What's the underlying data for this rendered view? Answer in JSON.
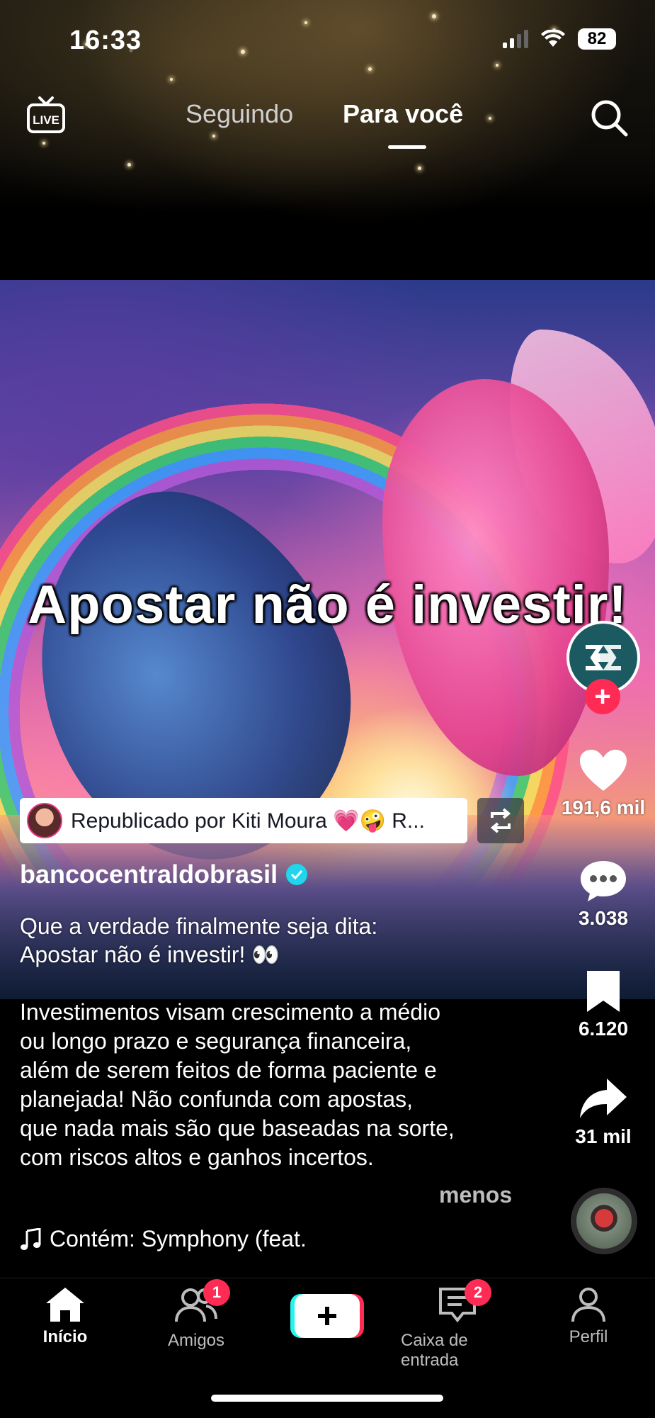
{
  "status_bar": {
    "time": "16:33",
    "battery": "82"
  },
  "top_nav": {
    "tabs": [
      {
        "label": "Seguindo",
        "active": false
      },
      {
        "label": "Para você",
        "active": true
      }
    ],
    "icons": [
      "live-icon",
      "search-icon"
    ]
  },
  "video": {
    "overlay_text": "Apostar não é investir!",
    "colors": {
      "accent": "#fe2c55",
      "verified": "#20d5ec"
    }
  },
  "right_rail": {
    "likes": "191,6 mil",
    "comments": "3.038",
    "saves": "6.120",
    "shares": "31 mil"
  },
  "post": {
    "repost_text": "Republicado por Kiti Moura 💗🤪 R...",
    "username": "bancocentraldobrasil",
    "caption_lines": [
      "Que a verdade finalmente seja dita:",
      "Apostar não é investir! 👀"
    ],
    "description_lines": [
      "Investimentos visam crescimento a médio",
      "ou longo prazo e segurança financeira,",
      "além de serem feitos de forma paciente e",
      "planejada! Não confunda com apostas,",
      "que nada mais são que baseadas na sorte,",
      "com riscos altos e ganhos incertos."
    ],
    "less_label": "menos",
    "music": "Contém: Symphony (feat."
  },
  "bottom_nav": {
    "items": [
      {
        "label": "Início"
      },
      {
        "label": "Amigos",
        "badge": "1"
      },
      {
        "label": ""
      },
      {
        "label": "Caixa de entrada",
        "badge": "2"
      },
      {
        "label": "Perfil"
      }
    ]
  }
}
